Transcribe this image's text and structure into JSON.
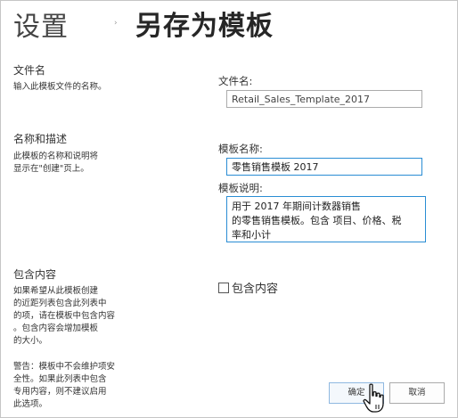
{
  "header": {
    "breadcrumb_root": "设置",
    "separator": "›",
    "page_title": "另存为模板"
  },
  "sections": [
    {
      "title": "文件名",
      "description": [
        "输入此模板文件的名称。"
      ]
    },
    {
      "title": "名称和描述",
      "description": [
        "此模板的名称和说明将",
        "显示在\"创建\"页上。"
      ]
    },
    {
      "title": "包含内容",
      "description": [
        "如果希望从此模板创建",
        "的近距列表包含此列表中",
        "的项，请在模板中包含内容",
        "。包含内容会增加模板",
        "的大小。"
      ],
      "warning": [
        "警告：模板中不会维护项安",
        "全性。如果此列表中包含",
        "专用内容，则不建议启用",
        "此选项。"
      ]
    }
  ],
  "form": {
    "file_name_label": "文件名:",
    "file_name_value": "Retail_Sales_Template_2017",
    "template_name_label": "模板名称:",
    "template_name_value": "零售销售模板 2017",
    "template_desc_label": "模板说明:",
    "template_desc_lines": [
      "用于 2017 年期间计数器销售",
      "的零售销售模板。包含 项目、价格、税",
      "率和小计"
    ],
    "include_content_label": "包含内容",
    "include_content_checked": false
  },
  "buttons": {
    "ok_label": "确定",
    "cancel_label": "取消"
  },
  "colors": {
    "focus_border": "#2a8dd4",
    "input_border": "#ababab",
    "frame_border": "#c6c6c6"
  }
}
